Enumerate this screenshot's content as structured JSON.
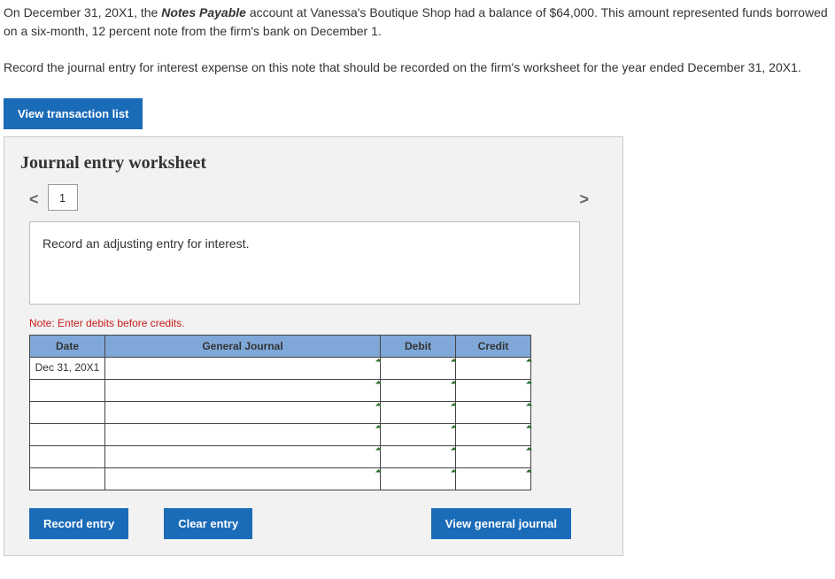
{
  "problem": {
    "line1_pre": "On December 31, 20X1, the ",
    "line1_em": "Notes Payable",
    "line1_post": " account at Vanessa's Boutique Shop had a balance of $64,000. This amount represented funds borrowed on a six-month, 12 percent note from the firm's bank on December 1."
  },
  "instruction": "Record the journal entry for interest expense on this note that should be recorded on the firm's worksheet for the year ended December 31, 20X1.",
  "buttons": {
    "view_transaction_list": "View transaction list",
    "record_entry": "Record entry",
    "clear_entry": "Clear entry",
    "view_general_journal": "View general journal"
  },
  "worksheet": {
    "title": "Journal entry worksheet",
    "tabs": [
      "1"
    ],
    "prev": "<",
    "next": ">",
    "hint": "Record an adjusting entry for interest.",
    "note": "Note: Enter debits before credits.",
    "headers": {
      "date": "Date",
      "gj": "General Journal",
      "debit": "Debit",
      "credit": "Credit"
    },
    "rows": [
      {
        "date": "Dec 31, 20X1",
        "gj": "",
        "debit": "",
        "credit": ""
      },
      {
        "date": "",
        "gj": "",
        "debit": "",
        "credit": ""
      },
      {
        "date": "",
        "gj": "",
        "debit": "",
        "credit": ""
      },
      {
        "date": "",
        "gj": "",
        "debit": "",
        "credit": ""
      },
      {
        "date": "",
        "gj": "",
        "debit": "",
        "credit": ""
      },
      {
        "date": "",
        "gj": "",
        "debit": "",
        "credit": ""
      }
    ]
  }
}
